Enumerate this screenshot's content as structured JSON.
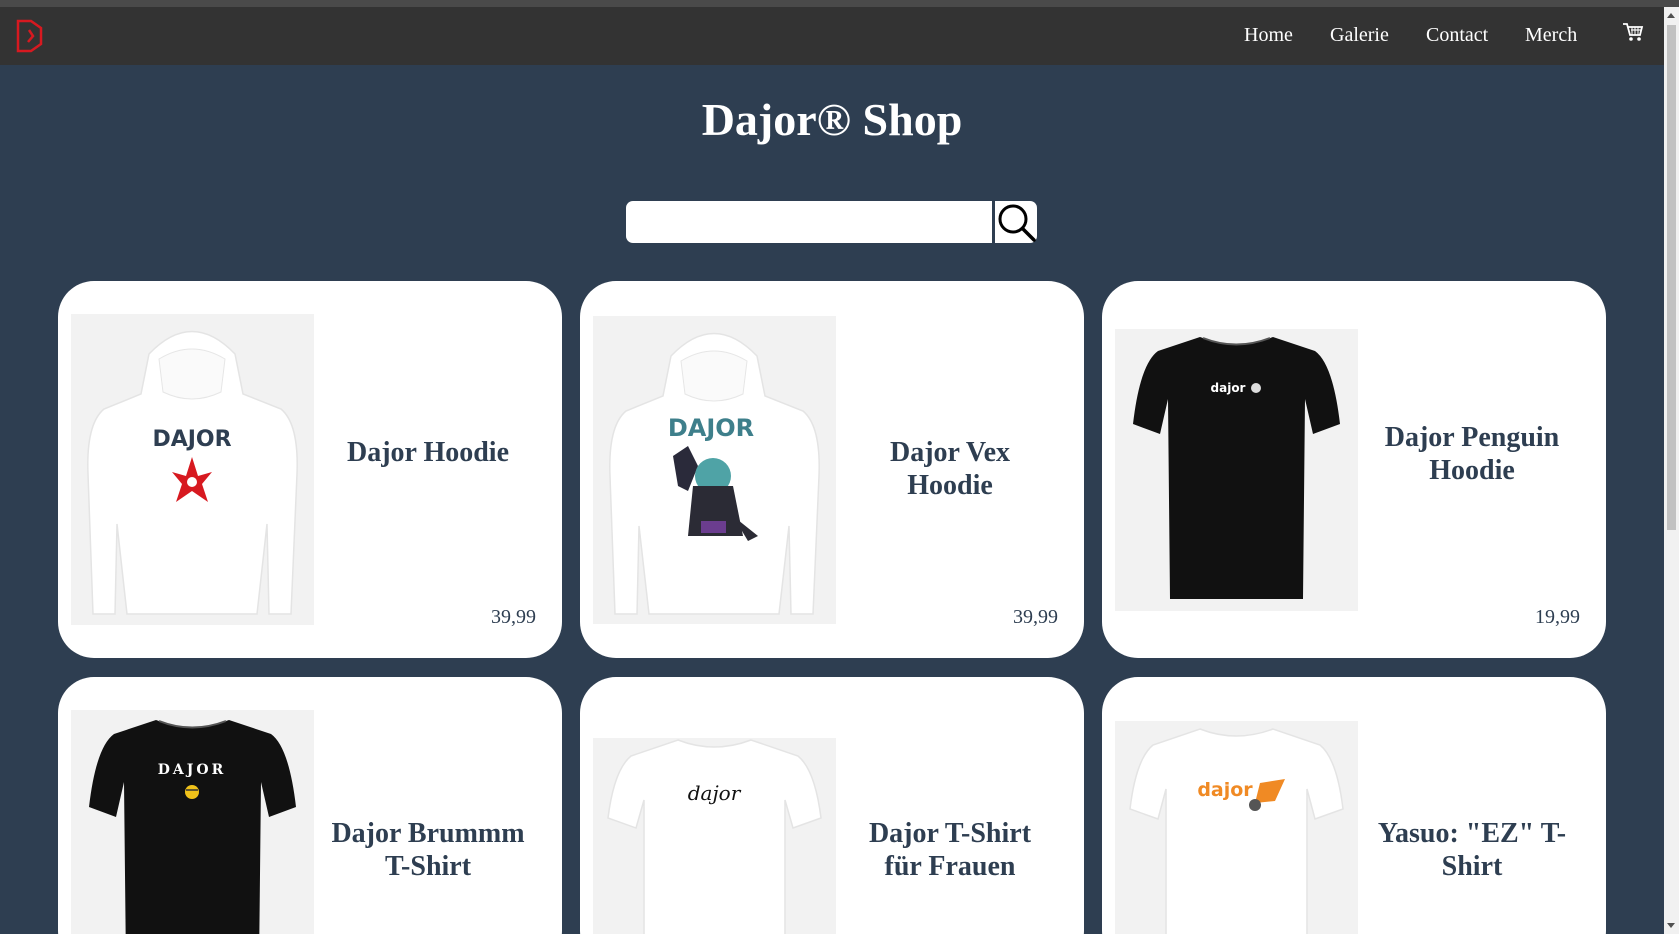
{
  "nav": {
    "links": [
      "Home",
      "Galerie",
      "Contact",
      "Merch"
    ],
    "logo_icon": "dajor-logo-icon",
    "cart_icon": "cart-icon",
    "logo_color": "#d71920"
  },
  "header": {
    "title": "Dajor® Shop"
  },
  "search": {
    "value": "",
    "placeholder": "",
    "button_icon": "search-icon"
  },
  "colors": {
    "background": "#2e3e51",
    "navbar": "#333333",
    "card": "#ffffff",
    "text": "#2e3e51"
  },
  "products": [
    {
      "name": "Dajor Hoodie",
      "price": "39,99",
      "image": "white-hoodie-dajor-star"
    },
    {
      "name": "Dajor Vex Hoodie",
      "price": "39,99",
      "image": "white-hoodie-dajor-vex"
    },
    {
      "name": "Dajor Penguin Hoodie",
      "price": "19,99",
      "image": "black-tshirt-dajor-penguin"
    },
    {
      "name": "Dajor Brummm T-Shirt",
      "price": "",
      "image": "black-tshirt-dajor-bee"
    },
    {
      "name": "Dajor T-Shirt für Frauen",
      "price": "",
      "image": "white-tshirt-dajor-script"
    },
    {
      "name": "Yasuo: \"EZ\" T-Shirt",
      "price": "",
      "image": "white-tshirt-dajor-ez"
    }
  ]
}
